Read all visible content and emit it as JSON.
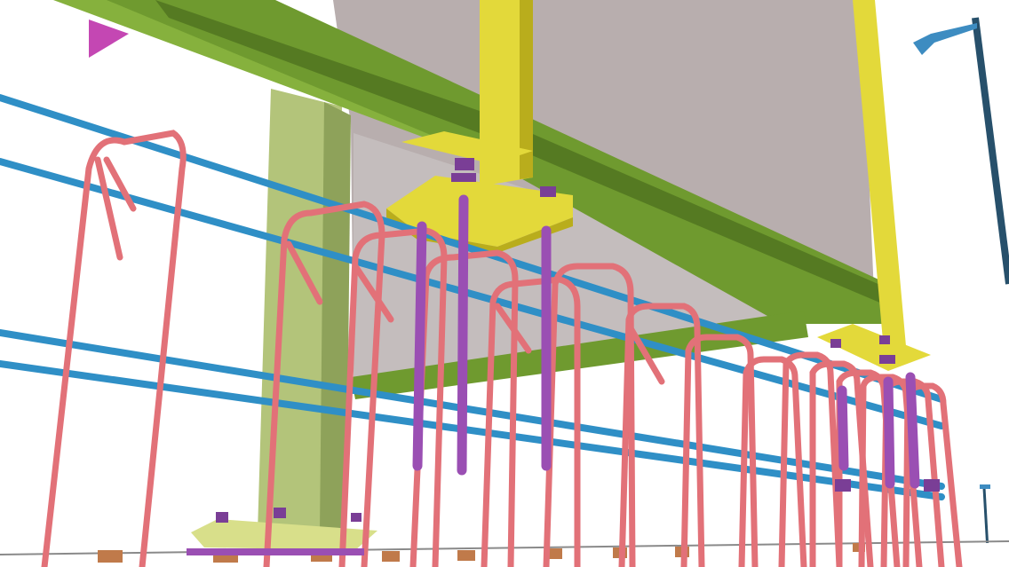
{
  "scene": {
    "description_visible_text": [],
    "colors": {
      "background": "#ffffff",
      "steel_beam": "#6f9a2f",
      "steel_beam_dark": "#557a22",
      "steel_beam_light": "#86b13d",
      "column": "#b3c47a",
      "column_dark": "#8ea25a",
      "base_plate": "#e3d93a",
      "base_plate_dark": "#b9ad1c",
      "wall_panel": "#b8aeae",
      "wall_panel_light": "#c9c3c3",
      "rebar_stirrup": "#e27178",
      "rebar_stirrup_dark": "#c45961",
      "rebar_longitudinal": "#2f8fc6",
      "rebar_longitudinal_dark": "#1f6f9e",
      "anchor_rod": "#9a4fb3",
      "anchor_nut": "#7a3e96",
      "light_pole": "#27506b",
      "light_head": "#3d8cc1",
      "ground_footing": "#c07a4a",
      "flag": "#c447b3"
    },
    "icons": [
      "light-pole-icon"
    ]
  }
}
